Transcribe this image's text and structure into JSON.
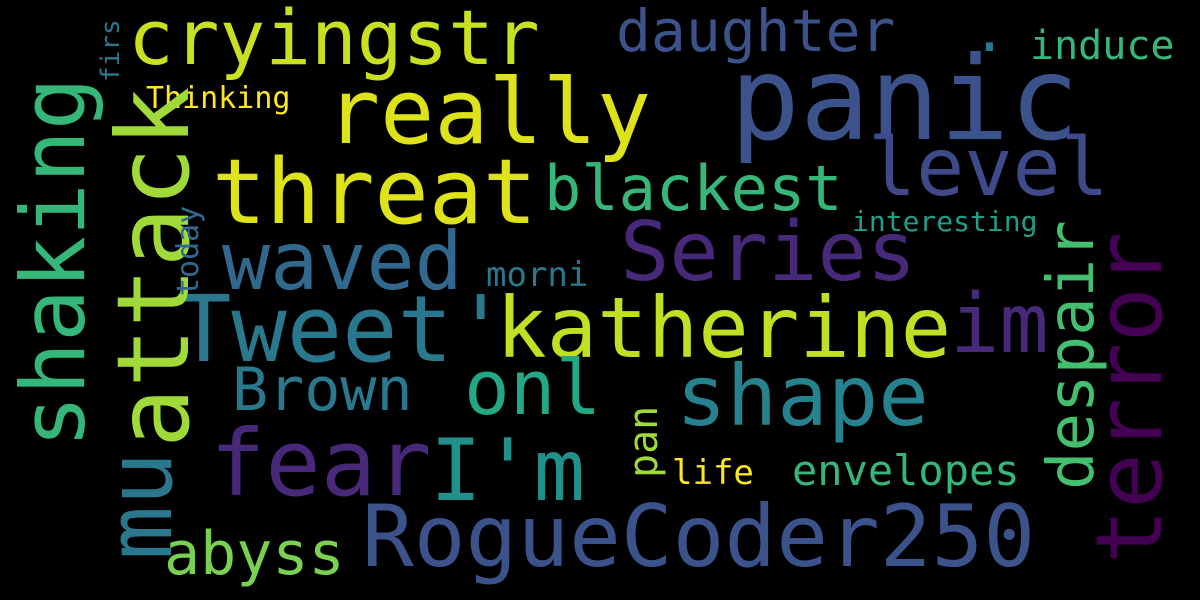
{
  "background": "#000000",
  "words": {
    "panic": {
      "text": "panic",
      "color": "#3b528b"
    },
    "cryingstr": {
      "text": "cryingstr",
      "color": "#c8e020"
    },
    "really": {
      "text": "really",
      "color": "#dde318"
    },
    "daughter": {
      "text": "daughter",
      "color": "#3b528b"
    },
    "dot": {
      "text": ".",
      "color": "#2a788e"
    },
    "induce": {
      "text": "induce",
      "color": "#35b779"
    },
    "Thinking": {
      "text": "Thinking",
      "color": "#fde725"
    },
    "level": {
      "text": "level",
      "color": "#3e4a89"
    },
    "threat": {
      "text": "threat",
      "color": "#dde318"
    },
    "blackest": {
      "text": "blackest",
      "color": "#35b779"
    },
    "interesting": {
      "text": "interesting",
      "color": "#1f9e89"
    },
    "Series": {
      "text": "Series",
      "color": "#482878"
    },
    "waved": {
      "text": "waved",
      "color": "#31688e"
    },
    "morni": {
      "text": "morni",
      "color": "#2a788e"
    },
    "Tweet": {
      "text": "Tweet'",
      "color": "#2a788e"
    },
    "katherine": {
      "text": "katherine",
      "color": "#c2df23"
    },
    "im": {
      "text": "im",
      "color": "#482878"
    },
    "Brown": {
      "text": "Brown",
      "color": "#2a788e"
    },
    "onl": {
      "text": "onl",
      "color": "#22a884"
    },
    "shape": {
      "text": "shape",
      "color": "#26828e"
    },
    "fear": {
      "text": "fear",
      "color": "#482878"
    },
    "Im2": {
      "text": "I'm",
      "color": "#21918c"
    },
    "life": {
      "text": "life",
      "color": "#fde725"
    },
    "envelopes": {
      "text": "envelopes",
      "color": "#35b779"
    },
    "RogueCoder": {
      "text": "RogueCoder250",
      "color": "#3b528b"
    },
    "abyss": {
      "text": "abyss",
      "color": "#7ad151"
    },
    "shaking": {
      "text": "shaking",
      "color": "#35b779"
    },
    "attack": {
      "text": "attack",
      "color": "#a0da39"
    },
    "mu": {
      "text": "mu",
      "color": "#2a788e"
    },
    "firs": {
      "text": "firs",
      "color": "#2a788e"
    },
    "today": {
      "text": "today",
      "color": "#31688e"
    },
    "pan": {
      "text": "pan",
      "color": "#a0da39"
    },
    "despair": {
      "text": "despair",
      "color": "#44bf70"
    },
    "terror": {
      "text": "terror",
      "color": "#440154"
    }
  }
}
